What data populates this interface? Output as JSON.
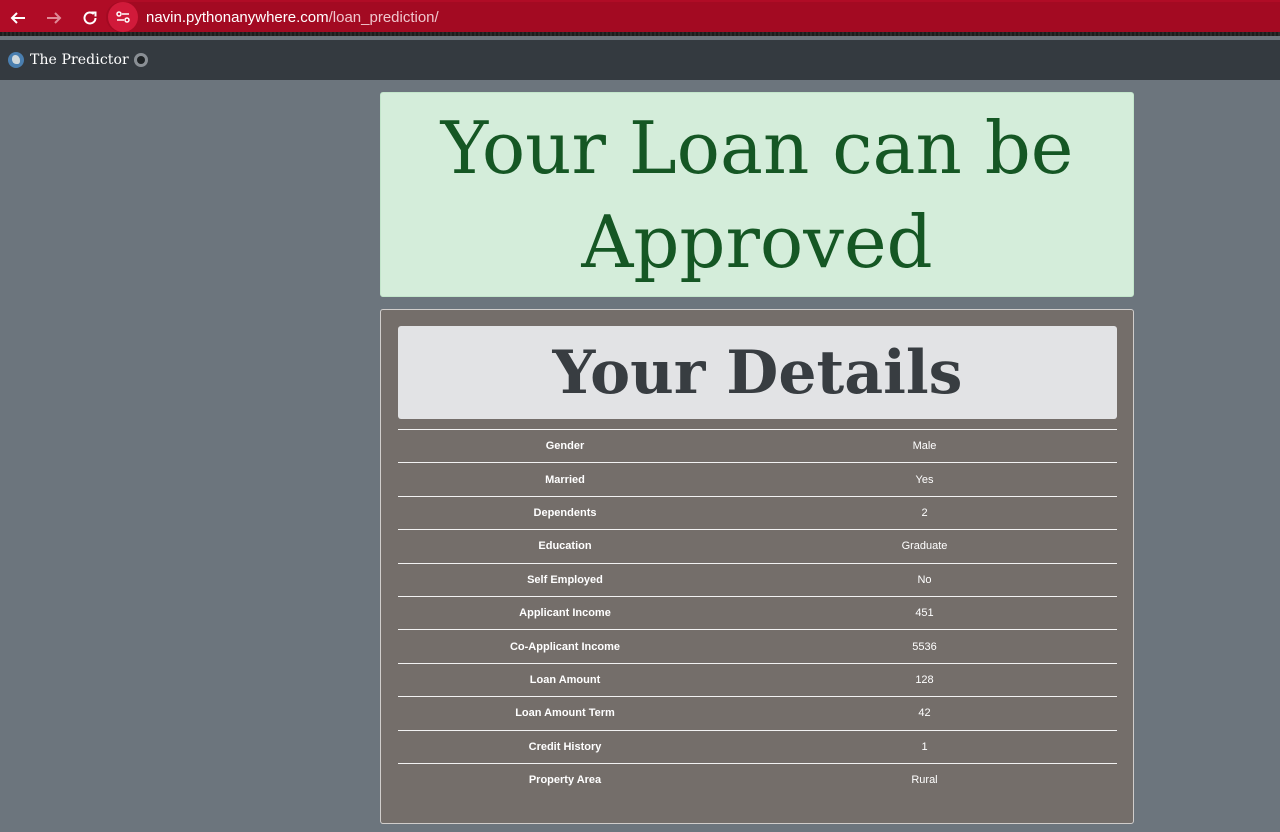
{
  "browser": {
    "back_icon": "arrow-left-icon",
    "forward_icon": "arrow-right-icon",
    "reload_icon": "reload-icon",
    "site_info_icon": "tune-icon",
    "url_host": "navin.pythonanywhere.com",
    "url_path": "/loan_prediction/",
    "accent_color": "#b00c26"
  },
  "navbar": {
    "brand": "The Predictor",
    "background": "#343a40"
  },
  "result": {
    "message": "Your Loan can be Approved",
    "color": "#155724",
    "background": "#d4edda"
  },
  "details": {
    "title": "Your Details",
    "rows": [
      {
        "label": "Gender",
        "value": "Male"
      },
      {
        "label": "Married",
        "value": "Yes"
      },
      {
        "label": "Dependents",
        "value": "2"
      },
      {
        "label": "Education",
        "value": "Graduate"
      },
      {
        "label": "Self Employed",
        "value": "No"
      },
      {
        "label": "Applicant Income",
        "value": "451"
      },
      {
        "label": "Co-Applicant Income",
        "value": "5536"
      },
      {
        "label": "Loan Amount",
        "value": "128"
      },
      {
        "label": "Loan Amount Term",
        "value": "42"
      },
      {
        "label": "Credit History",
        "value": "1"
      },
      {
        "label": "Property Area",
        "value": "Rural"
      }
    ]
  }
}
